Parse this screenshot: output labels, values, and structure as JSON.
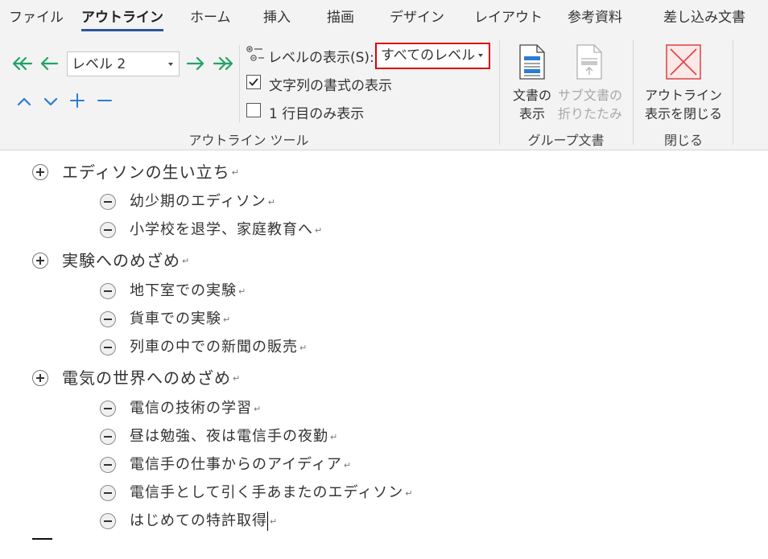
{
  "tabs": {
    "file": "ファイル",
    "outline": "アウトライン",
    "home": "ホーム",
    "insert": "挿入",
    "draw": "描画",
    "design": "デザイン",
    "layout": "レイアウト",
    "references": "参考資料",
    "mailings": "差し込み文書"
  },
  "ribbon": {
    "level_combo_value": "レベル 2",
    "show_level_label": "レベルの表示(S):",
    "show_level_value": "すべてのレベル",
    "show_formatting_label": "文字列の書式の表示",
    "show_formatting_checked": true,
    "first_line_only_label": "1 行目のみ表示",
    "first_line_only_checked": false,
    "outline_tools_group": "アウトライン ツール",
    "show_document_line1": "文書の",
    "show_document_line2": "表示",
    "collapse_subdocs_line1": "サブ文書の",
    "collapse_subdocs_line2": "折りたたみ",
    "master_doc_group": "グループ文書",
    "close_outline_line1": "アウトライン",
    "close_outline_line2": "表示を閉じる",
    "close_group": "閉じる",
    "colors": {
      "arrow_green": "#21a366",
      "move_blue": "#2b7cd3",
      "highlight_border": "#e00000",
      "close_red": "#e04040"
    }
  },
  "document": {
    "paragraph_mark": "↵",
    "items": [
      {
        "level": 1,
        "text": "エディソンの生い立ち"
      },
      {
        "level": 2,
        "text": "幼少期のエディソン"
      },
      {
        "level": 2,
        "text": "小学校を退学、家庭教育へ"
      },
      {
        "level": 1,
        "text": "実験へのめざめ"
      },
      {
        "level": 2,
        "text": "地下室での実験"
      },
      {
        "level": 2,
        "text": "貨車での実験"
      },
      {
        "level": 2,
        "text": "列車の中での新聞の販売"
      },
      {
        "level": 1,
        "text": "電気の世界へのめざめ"
      },
      {
        "level": 2,
        "text": "電信の技術の学習"
      },
      {
        "level": 2,
        "text": "昼は勉強、夜は電信手の夜勤"
      },
      {
        "level": 2,
        "text": "電信手の仕事からのアイディア"
      },
      {
        "level": 2,
        "text": "電信手として引く手あまたのエディソン"
      },
      {
        "level": 2,
        "text": "はじめての特許取得"
      }
    ]
  }
}
